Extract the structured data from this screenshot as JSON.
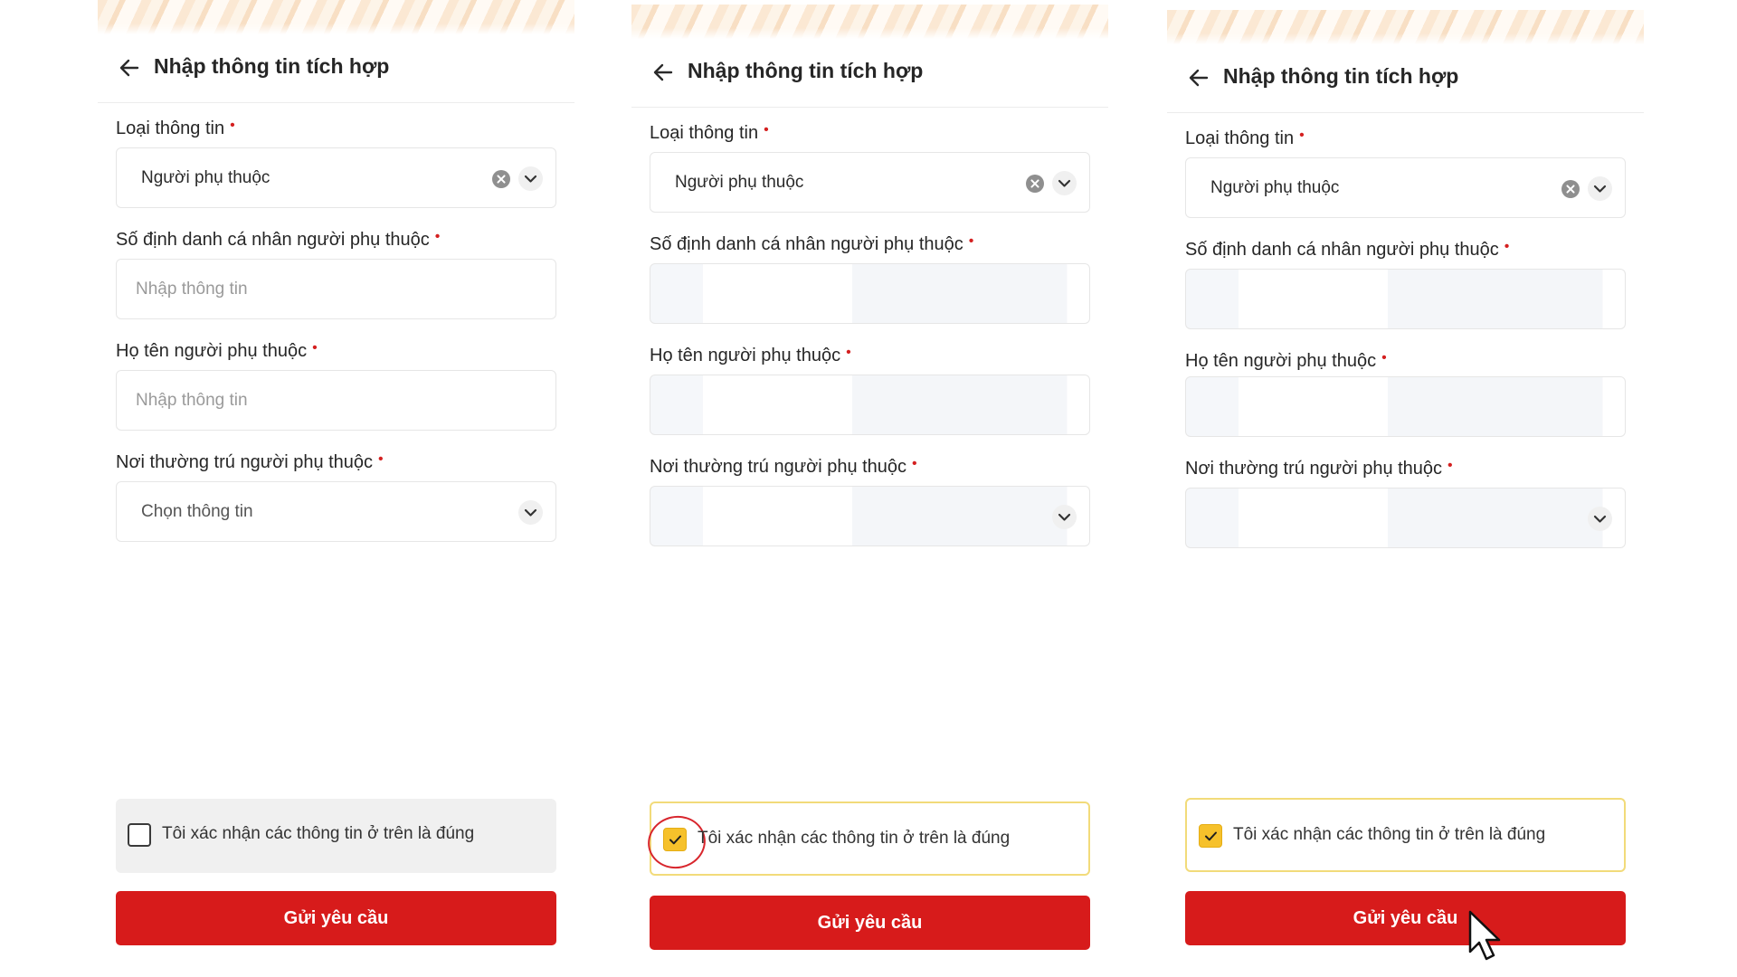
{
  "colors": {
    "accent_red": "#d71b1b",
    "required_dot": "#d42020",
    "checkbox_yellow": "#f6c12b",
    "confirm_border": "#f2db7a"
  },
  "header": {
    "title": "Nhập thông tin tích hợp",
    "back_icon": "arrow-left-icon"
  },
  "form": {
    "type_label": "Loại thông tin",
    "type_value": "Người phụ thuộc",
    "id_label": "Số định danh cá nhân người phụ thuộc",
    "name_label": "Họ tên người phụ thuộc",
    "residence_label": "Nơi thường trú người phụ thuộc",
    "required_mark": "•",
    "input_placeholder": "Nhập thông tin",
    "select_placeholder": "Chọn thông tin",
    "clear_icon": "clear-circle-icon",
    "dropdown_icon": "chevron-down-icon"
  },
  "confirm": {
    "text": "Tôi xác nhận các thông tin ở trên là đúng"
  },
  "submit": {
    "label": "Gửi yêu cầu"
  },
  "panels": [
    {
      "step": 1,
      "checkbox_checked": false,
      "fields_filled": false
    },
    {
      "step": 2,
      "checkbox_checked": true,
      "fields_filled": true,
      "annotation": "red-circle-highlight"
    },
    {
      "step": 3,
      "checkbox_checked": true,
      "fields_filled": true,
      "cursor": "mouse-pointer-icon"
    }
  ]
}
